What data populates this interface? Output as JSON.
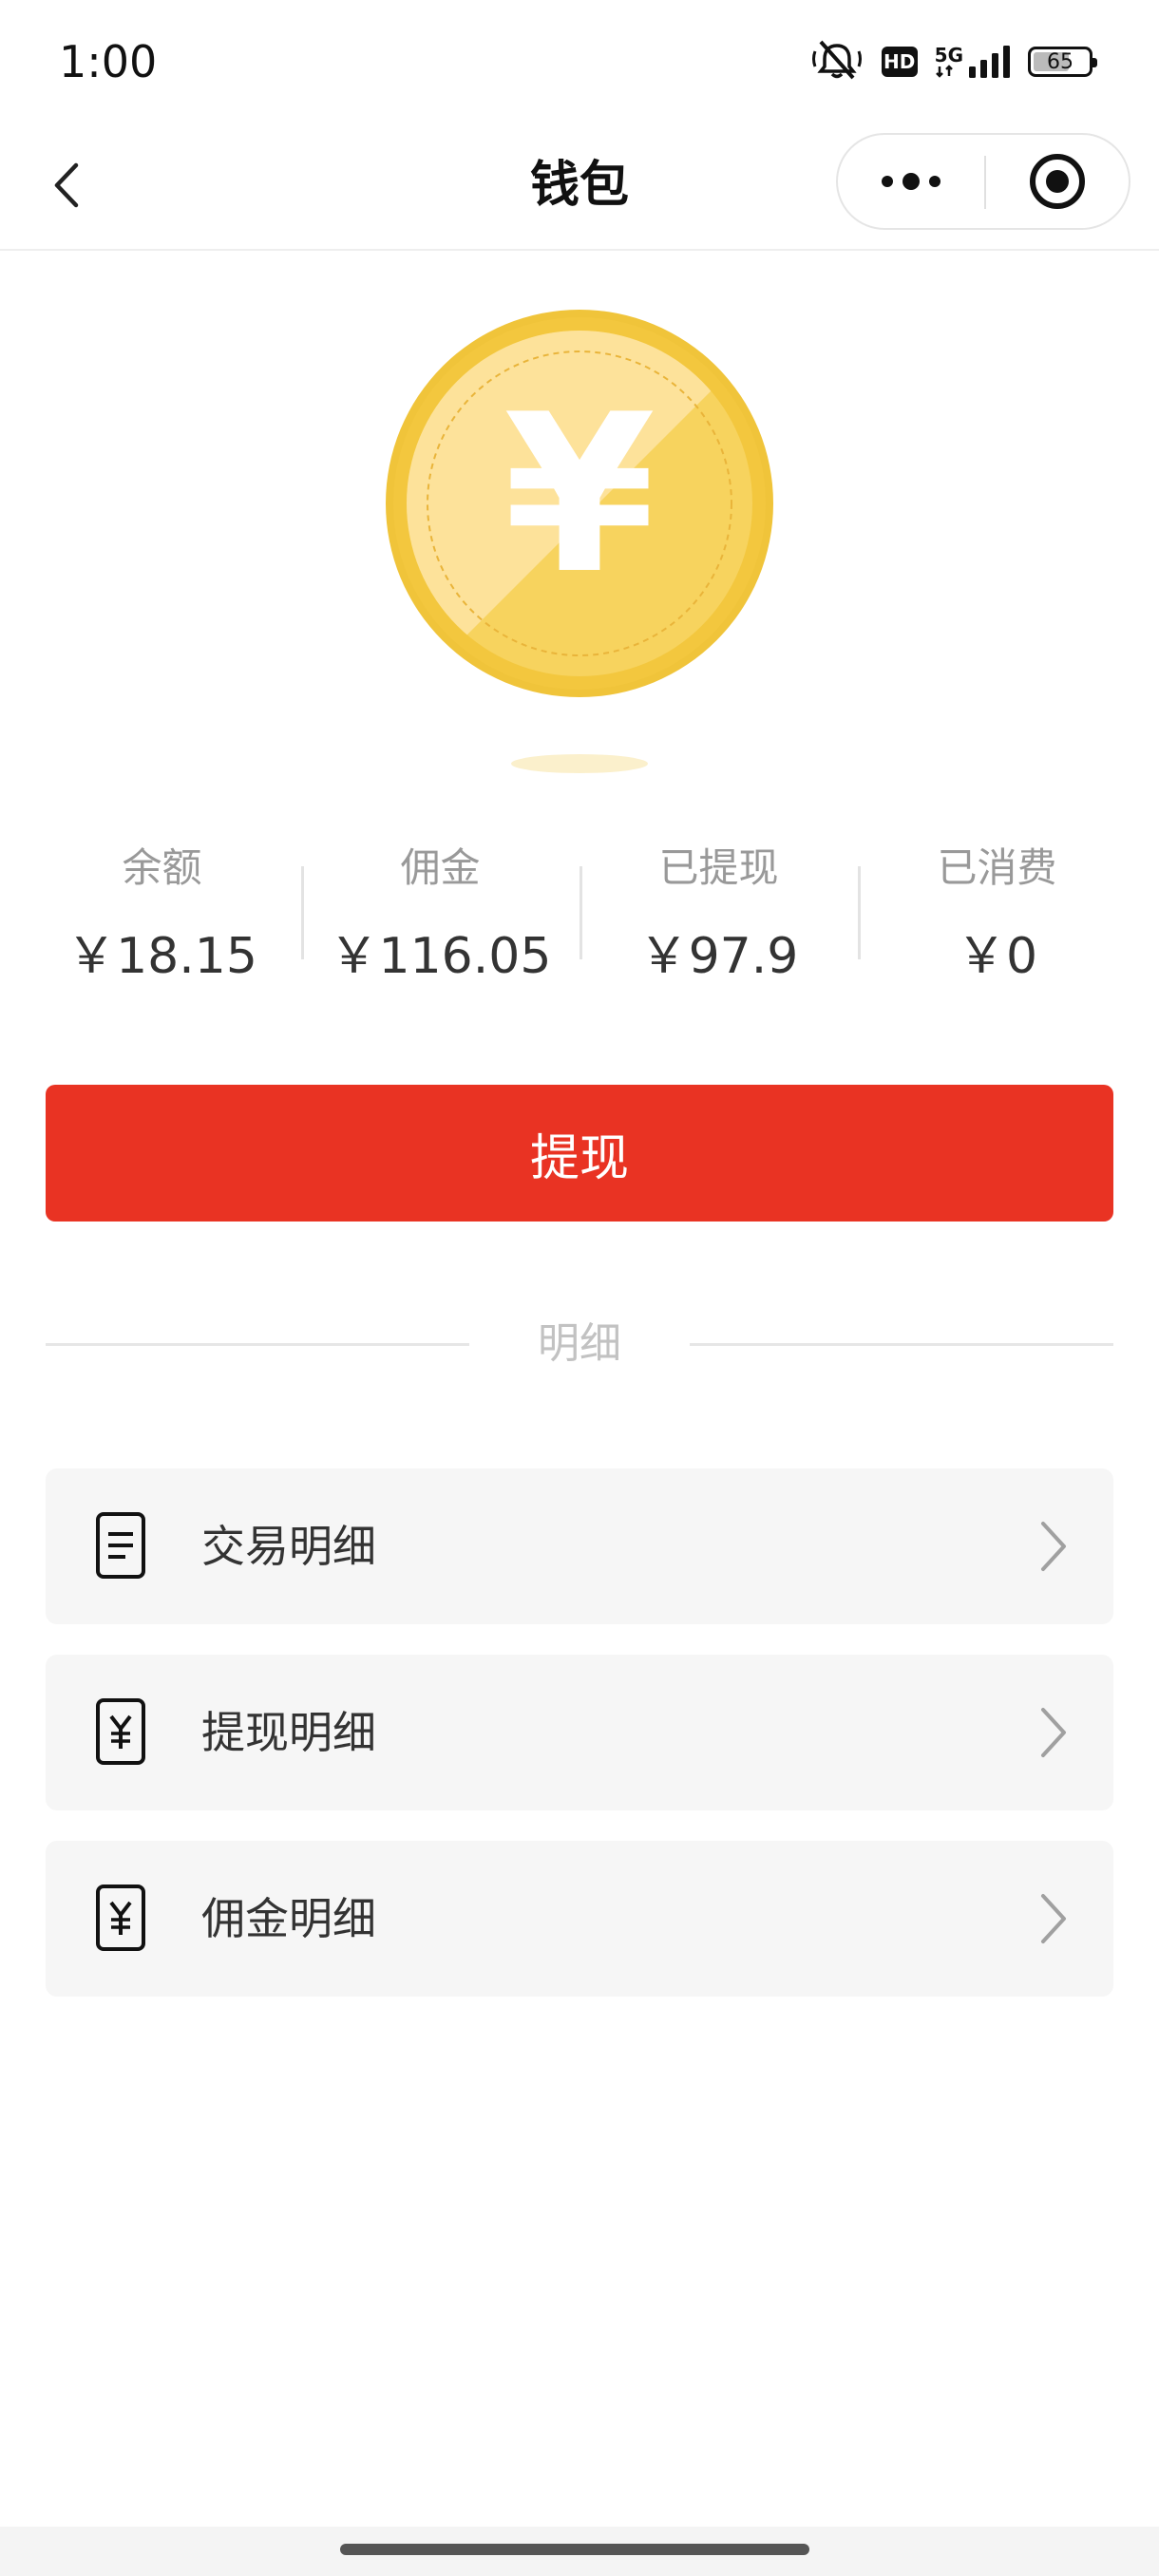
{
  "status_bar": {
    "time": "1:00",
    "hd_label": "HD",
    "network_label": "5G",
    "battery_level": "65"
  },
  "nav": {
    "title": "钱包"
  },
  "coin": {
    "symbol": "¥",
    "colors": {
      "outer": "#f0c43a",
      "inner": "#f8d970",
      "highlight": "#fde8a4"
    }
  },
  "stats": [
    {
      "label": "余额",
      "value": "￥18.15"
    },
    {
      "label": "佣金",
      "value": "￥116.05"
    },
    {
      "label": "已提现",
      "value": "￥97.9"
    },
    {
      "label": "已消费",
      "value": "￥0"
    }
  ],
  "withdraw_button": {
    "label": "提现",
    "color": "#e93323"
  },
  "section": {
    "title": "明细"
  },
  "details": [
    {
      "label": "交易明细",
      "icon": "document-icon"
    },
    {
      "label": "提现明细",
      "icon": "yuan-document-icon"
    },
    {
      "label": "佣金明细",
      "icon": "yuan-document-icon"
    }
  ]
}
